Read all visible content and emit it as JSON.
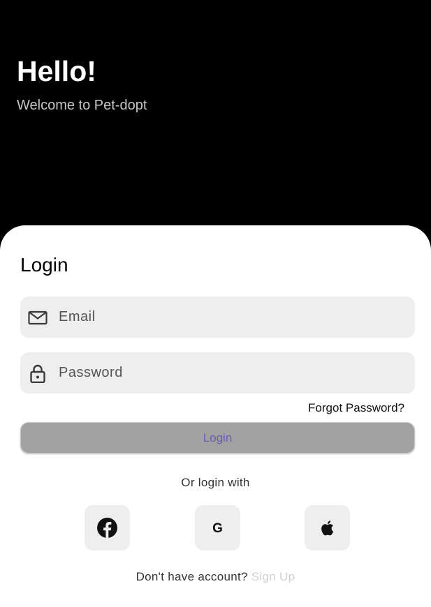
{
  "header": {
    "greeting": "Hello!",
    "subtitle": "Welcome to Pet-dopt"
  },
  "login_card": {
    "title": "Login",
    "email_placeholder": "Email",
    "email_value": "",
    "password_placeholder": "Password",
    "password_value": "",
    "forgot_password": "Forgot Password?",
    "login_button": "Login",
    "or_login_with": "Or login with",
    "social_buttons": [
      {
        "icon": "facebook-icon"
      },
      {
        "icon": "google-icon",
        "glyph": "G"
      },
      {
        "icon": "apple-icon"
      }
    ],
    "no_account_text": "Don't have account?",
    "sign_up_link": "Sign Up"
  },
  "colors": {
    "header_bg": "#000000",
    "card_bg": "#ffffff",
    "field_bg": "#eeeeee",
    "login_button_bg": "#a2a2a2",
    "login_button_text": "#6b5bab",
    "sign_up_link": "#d0d0d0"
  }
}
